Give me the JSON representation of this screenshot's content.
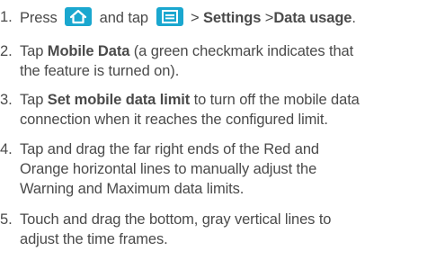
{
  "steps": [
    {
      "number": "1.",
      "parts": {
        "press": "Press",
        "and_tap": "and tap",
        "sep1": ">",
        "settings": "Settings",
        "sep2": ">",
        "data_usage": "Data usage",
        "period": "."
      },
      "icons": {
        "home": "home-icon",
        "menu": "menu-icon"
      }
    },
    {
      "number": "2.",
      "tap": "Tap",
      "bold": "Mobile Data",
      "rest_line1": "(a green checkmark indicates that",
      "line2": "the feature is turned on)."
    },
    {
      "number": "3.",
      "tap": "Tap",
      "bold": "Set mobile data limit",
      "rest_line1": "to turn off the mobile data",
      "line2": "connection when it reaches the configured limit."
    },
    {
      "number": "4.",
      "line1": "Tap and drag the far right ends of the Red and",
      "line2": "Orange horizontal lines to manually adjust the",
      "line3": "Warning and Maximum data limits."
    },
    {
      "number": "5.",
      "line1": "Touch and drag the bottom, gray vertical lines to",
      "line2": "adjust the time frames."
    }
  ],
  "colors": {
    "text": "#4a4a4a",
    "key_bg": "#1aa7cf"
  }
}
